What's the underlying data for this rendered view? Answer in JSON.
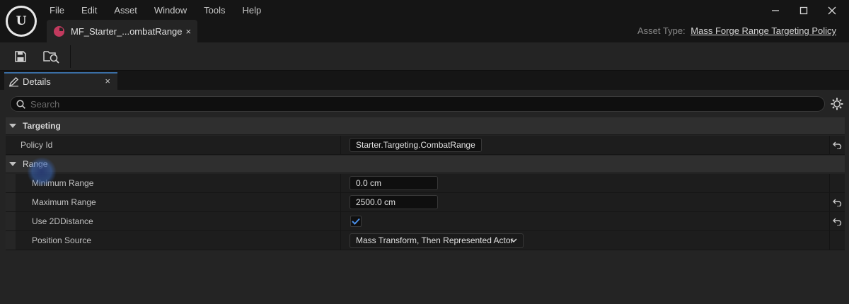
{
  "menu": [
    "File",
    "Edit",
    "Asset",
    "Window",
    "Tools",
    "Help"
  ],
  "document_tab": {
    "label": "MF_Starter_...ombatRange",
    "close": "×"
  },
  "asset_type": {
    "label": "Asset Type:",
    "value": "Mass Forge Range Targeting Policy"
  },
  "panel_tab": {
    "label": "Details",
    "close": "×"
  },
  "search": {
    "placeholder": "Search",
    "value": ""
  },
  "categories": {
    "targeting": "Targeting",
    "range": "Range"
  },
  "properties": {
    "policy_id": {
      "label": "Policy Id",
      "value": "Starter.Targeting.CombatRange"
    },
    "minimum_range": {
      "label": "Minimum Range",
      "value": "0.0 cm"
    },
    "maximum_range": {
      "label": "Maximum Range",
      "value": "2500.0 cm"
    },
    "use_2d_distance": {
      "label": "Use 2DDistance",
      "checked": true
    },
    "position_source": {
      "label": "Position Source",
      "value": "Mass Transform, Then Represented Actor"
    }
  },
  "icons": {
    "logo": "unreal-logo-icon",
    "save": "save-icon",
    "browse": "browse-to-asset-icon",
    "edit": "pencil-icon",
    "search": "search-icon",
    "settings": "gear-icon",
    "reset": "reset-to-default-icon",
    "dropdown": "chevron-down-icon",
    "check": "checkmark-icon"
  },
  "colors": {
    "accent": "#3a6ea5",
    "asset_icon": "#c23a5e",
    "checkmark": "#4a8fe8"
  }
}
